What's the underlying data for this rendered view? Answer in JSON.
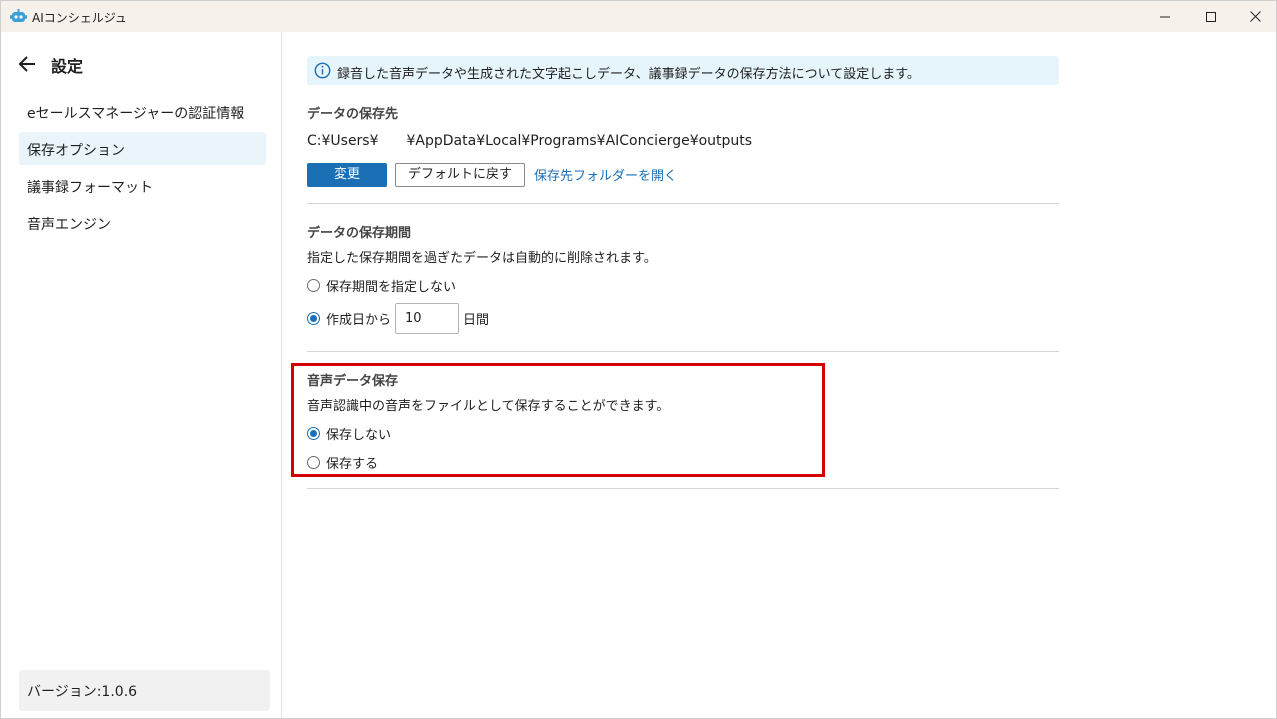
{
  "window": {
    "title": "AIコンシェルジュ"
  },
  "sidebar": {
    "title": "設定",
    "items": [
      {
        "label": "eセールスマネージャーの認証情報"
      },
      {
        "label": "保存オプション"
      },
      {
        "label": "議事録フォーマット"
      },
      {
        "label": "音声エンジン"
      }
    ],
    "active_item": "保存オプション",
    "version": "バージョン:1.0.6"
  },
  "info": {
    "text": "録音した音声データや生成された文字起こしデータ、議事録データの保存方法について設定します。"
  },
  "storage_location": {
    "title": "データの保存先",
    "path": "C:¥Users¥　　¥AppData¥Local¥Programs¥AIConcierge¥outputs",
    "change_label": "変更",
    "default_label": "デフォルトに戻す",
    "open_folder_label": "保存先フォルダーを開く"
  },
  "retention": {
    "title": "データの保存期間",
    "description": "指定した保存期間を過ぎたデータは自動的に削除されます。",
    "option_none": "保存期間を指定しない",
    "option_from_created": "作成日から",
    "days_value": "10",
    "days_unit": "日間",
    "selected": "作成日から"
  },
  "audio_save": {
    "title": "音声データ保存",
    "description": "音声認識中の音声をファイルとして保存することができます。",
    "option_no": "保存しない",
    "option_yes": "保存する",
    "selected": "保存しない"
  },
  "colors": {
    "accent": "#1a6fb5",
    "highlight": "#d40000",
    "titlebar": "#f6f1ea",
    "info_bg": "#e6f4fb",
    "active_nav_bg": "#e9f4fb"
  }
}
